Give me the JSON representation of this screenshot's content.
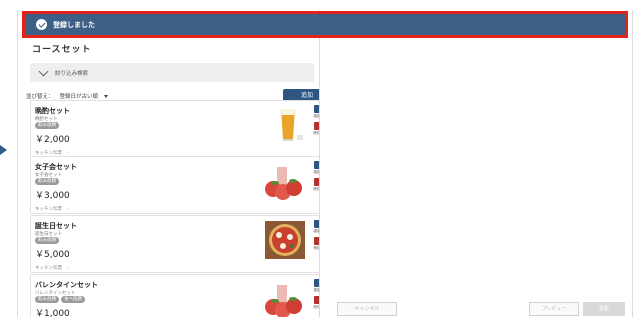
{
  "toast": {
    "message": "登録しました",
    "icon": "check-circle-icon",
    "background": "#3e5f85",
    "highlight_border": "#e5221a"
  },
  "list": {
    "title": "コースセット",
    "filter_label": "絞り込み検索",
    "sort_label": "並び替え：",
    "sort_value": "登録日が古い順",
    "add_label": "追加",
    "accent": "#2f5682"
  },
  "menu_items": [
    {
      "name": "晩酌セット",
      "kana": "晩酌セット",
      "tags": [
        "飲み放題"
      ],
      "price": "￥2,000",
      "kitchen": "キッチン伝票　-",
      "image": "beer-glass"
    },
    {
      "name": "女子会セット",
      "kana": "女子会セット",
      "tags": [
        "飲み放題"
      ],
      "price": "￥3,000",
      "kitchen": "キッチン伝票　-",
      "image": "peach-drink"
    },
    {
      "name": "誕生日セット",
      "kana": "誕生日セット",
      "tags": [
        "飲み放題"
      ],
      "price": "￥5,000",
      "kitchen": "キッチン伝票　-",
      "image": "pizza"
    },
    {
      "name": "バレンタインセット",
      "kana": "バレンタインセット",
      "tags": [
        "飲み放題",
        "食べ放題"
      ],
      "price": "￥1,000",
      "kitchen": "",
      "image": "peach-drink"
    }
  ],
  "actions": {
    "duplicate": "複製",
    "delete": "削除"
  },
  "footer": {
    "cancel": "キャンセル",
    "preview": "プレビュー",
    "save": "更新"
  }
}
